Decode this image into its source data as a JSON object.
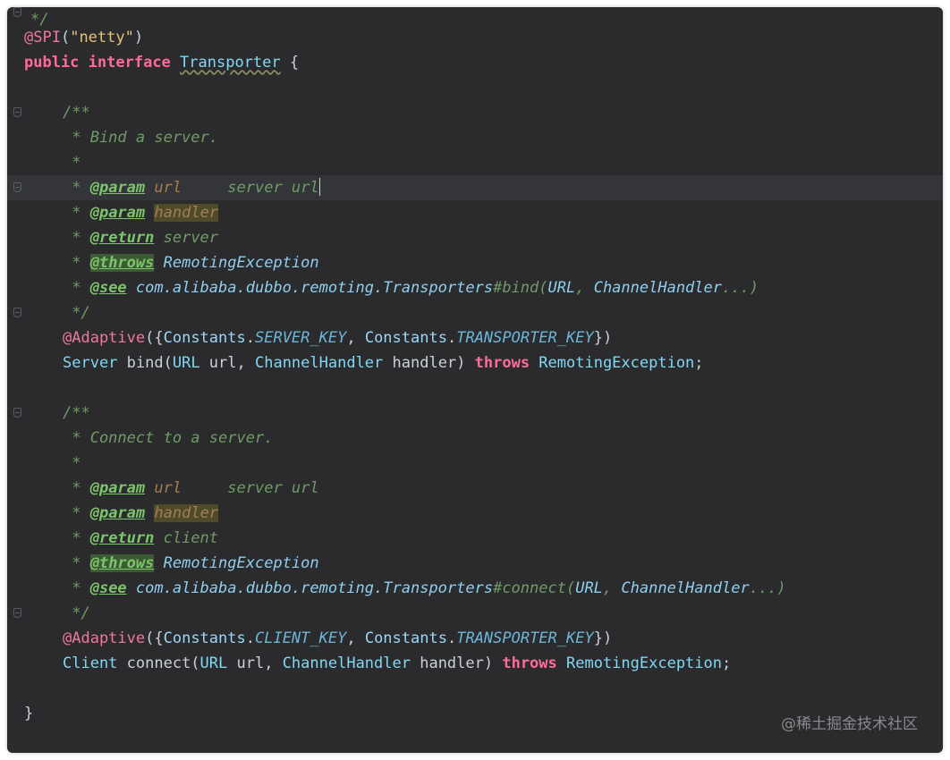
{
  "editor": {
    "line_01": "*/",
    "line_02": {
      "annotation": "@SPI",
      "open": "(",
      "string": "\"netty\"",
      "close": ")"
    },
    "line_03": {
      "kw1": "public",
      "kw2": "interface",
      "name": "Transporter",
      "brace": "{"
    },
    "doc1": {
      "open": "/**",
      "desc": " * Bind a server.",
      "star": " *",
      "param_url": {
        "prefix": " * ",
        "tag": "@param",
        "name": "url",
        "text": "     server url"
      },
      "param_handler": {
        "prefix": " * ",
        "tag": "@param",
        "name": "handler"
      },
      "return": {
        "prefix": " * ",
        "tag": "@return",
        "text": " server"
      },
      "throws": {
        "prefix": " * ",
        "tag": "@throws",
        "text": " RemotingException"
      },
      "see": {
        "prefix": " * ",
        "tag": "@see",
        "pkg": " com.alibaba.dubbo.remoting.",
        "cls": "Transporters",
        "method": "#bind(",
        "a1": "URL",
        "sep": ", ",
        "a2": "ChannelHandler",
        "end": "...)"
      },
      "close": " */"
    },
    "bind_annotation": {
      "ann": "@Adaptive",
      "p1": "({",
      "c1": "Constants",
      "d1": ".",
      "k1": "SERVER_KEY",
      "s": ", ",
      "c2": "Constants",
      "d2": ".",
      "k2": "TRANSPORTER_KEY",
      "p2": "})"
    },
    "bind_method": {
      "ret": "Server",
      "name": " bind(",
      "t1": "URL",
      "a1": " url, ",
      "t2": "ChannelHandler",
      "a2": " handler) ",
      "throws": "throws",
      "ex": " RemotingException",
      "end": ";"
    },
    "doc2": {
      "open": "/**",
      "desc": " * Connect to a server.",
      "star": " *",
      "param_url": {
        "prefix": " * ",
        "tag": "@param",
        "name": "url",
        "text": "     server url"
      },
      "param_handler": {
        "prefix": " * ",
        "tag": "@param",
        "name": "handler"
      },
      "return": {
        "prefix": " * ",
        "tag": "@return",
        "text": " client"
      },
      "throws": {
        "prefix": " * ",
        "tag": "@throws",
        "text": " RemotingException"
      },
      "see": {
        "prefix": " * ",
        "tag": "@see",
        "pkg": " com.alibaba.dubbo.remoting.",
        "cls": "Transporters",
        "method": "#connect(",
        "a1": "URL",
        "sep": ", ",
        "a2": "ChannelHandler",
        "end": "...)"
      },
      "close": " */"
    },
    "connect_annotation": {
      "ann": "@Adaptive",
      "p1": "({",
      "c1": "Constants",
      "d1": ".",
      "k1": "CLIENT_KEY",
      "s": ", ",
      "c2": "Constants",
      "d2": ".",
      "k2": "TRANSPORTER_KEY",
      "p2": "})"
    },
    "connect_method": {
      "ret": "Client",
      "name": " connect(",
      "t1": "URL",
      "a1": " url, ",
      "t2": "ChannelHandler",
      "a2": " handler) ",
      "throws": "throws",
      "ex": " RemotingException",
      "end": ";"
    },
    "closing_brace": "}"
  },
  "watermark": "@稀土掘金技术社区",
  "colors": {
    "background": "#2b2b2d",
    "keyword": "#ff6a98",
    "comment": "#6f9b64",
    "type": "#7fd8f4",
    "string": "#e4c47a"
  }
}
